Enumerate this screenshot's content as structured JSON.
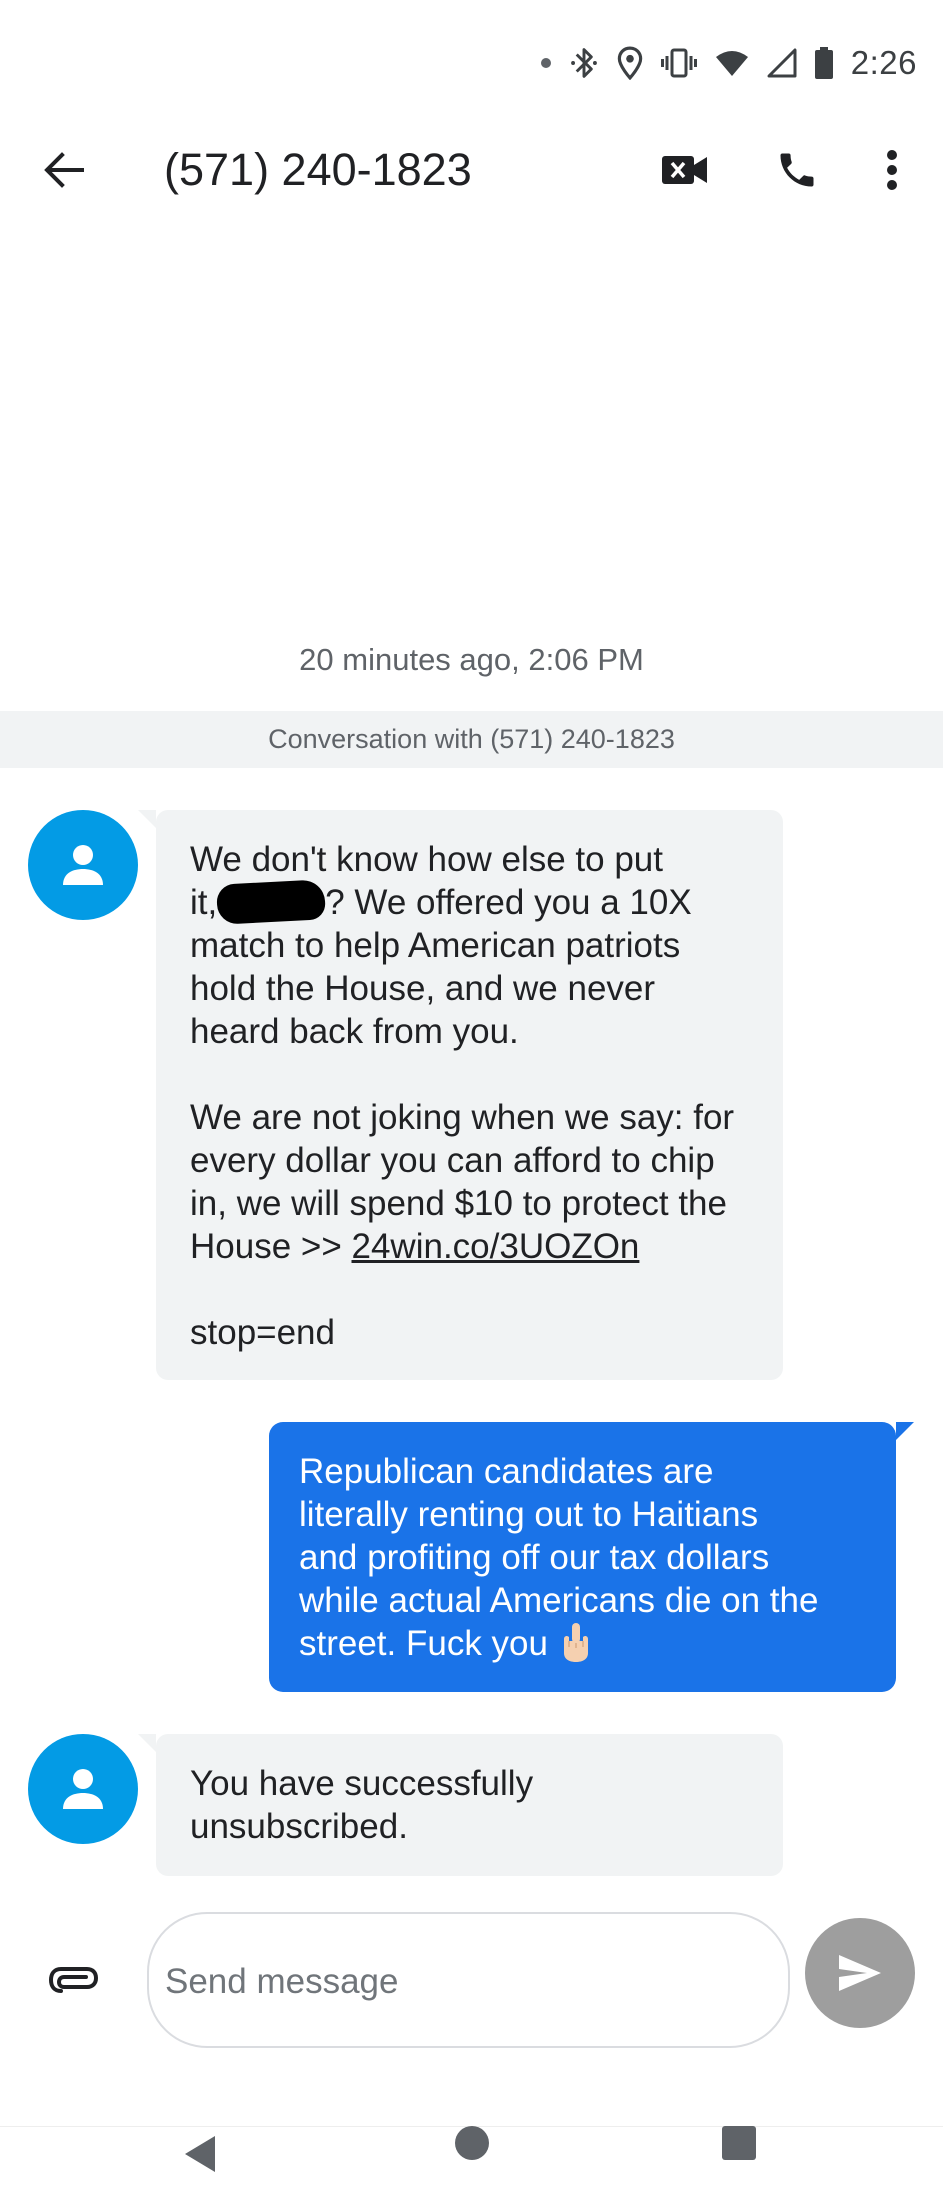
{
  "status_bar": {
    "time": "2:26",
    "icons": [
      "notification-dot-icon",
      "bluetooth-icon",
      "location-icon",
      "vibrate-icon",
      "wifi-icon",
      "signal-icon",
      "battery-icon"
    ]
  },
  "app_bar": {
    "title": "(571) 240-1823",
    "icons": [
      "back-arrow-icon",
      "video-call-icon",
      "phone-icon",
      "more-vert-icon"
    ]
  },
  "conversation": {
    "timestamp": "20 minutes ago, 2:06 PM",
    "banner": "Conversation with (571) 240-1823",
    "messages": [
      {
        "direction": "incoming",
        "para1_line1": "We don't know how else to put",
        "para1_line2_a": "it,",
        "para1_line2_b": "? We offered you a 10X",
        "para1_line3": "match to help American patriots",
        "para1_line4": "hold the House, and we never",
        "para1_line5": "heard back from you.",
        "para2_line1": "We are not joking when we say: for",
        "para2_line2": "every dollar you can afford to chip",
        "para2_line3": "in, we will spend $10 to protect the",
        "para2_line4_a": "House >> ",
        "link": "24win.co/3UOZOn",
        "para3": "stop=end"
      },
      {
        "direction": "outgoing",
        "line1": "Republican candidates are",
        "line2": "literally renting out to Haitians",
        "line3": "and profiting off our tax dollars",
        "line4": "while actual Americans die on the",
        "line5": "street. Fuck you",
        "emoji": "middle-finger-emoji"
      },
      {
        "direction": "incoming",
        "line1": "You have successfully",
        "line2": "unsubscribed."
      }
    ]
  },
  "composer": {
    "placeholder": "Send message",
    "value": ""
  },
  "colors": {
    "incoming_bubble": "#f1f3f4",
    "outgoing_bubble": "#1a73e8",
    "avatar": "#039be5",
    "send_button": "#9e9e9e"
  }
}
